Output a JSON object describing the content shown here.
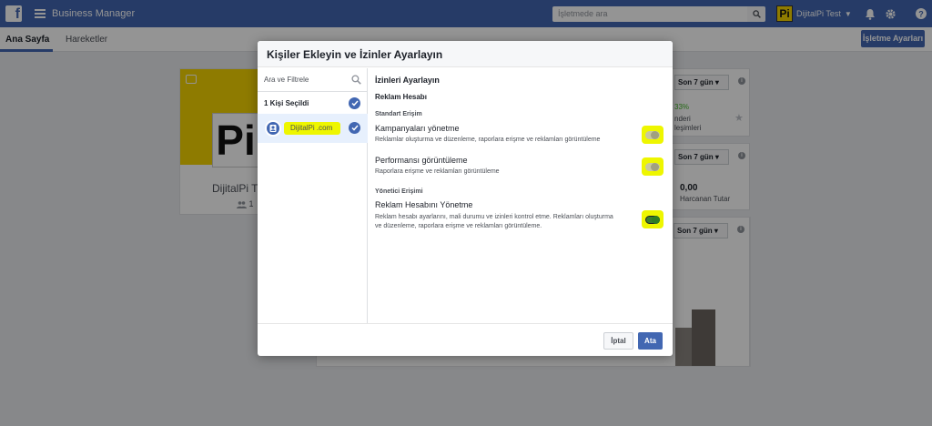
{
  "topbar": {
    "logo_letter": "f",
    "app_title": "Business Manager",
    "search_placeholder": "İşletmede ara",
    "account_logo": "Pi",
    "account_name": "DijitalPi Test",
    "icons": [
      "bell-icon",
      "gear-icon",
      "help-icon"
    ]
  },
  "subnav": {
    "tabs": [
      {
        "label": "Ana Sayfa",
        "active": true
      },
      {
        "label": "Hareketler",
        "active": false
      }
    ],
    "settings_button": "İşletme Ayarları"
  },
  "background": {
    "profile": {
      "logo_text": "Pi",
      "name": "DijitalPi T",
      "count": "1"
    },
    "cards": [
      {
        "select": "Son 7 gün",
        "line1": "33%",
        "line2": "nderi",
        "line3": "leşimleri"
      },
      {
        "select": "Son 7 gün",
        "value": "0,00",
        "label": "Harcanan Tutar"
      },
      {
        "select": "Son 7 gün"
      }
    ]
  },
  "modal": {
    "title": "Kişiler Ekleyin ve İzinler Ayarlayın",
    "left": {
      "search_placeholder": "Ara ve Filtrele",
      "selected_label": "1 Kişi Seçildi",
      "person_name": "DijitalPi .com"
    },
    "right": {
      "title": "İzinleri Ayarlayın",
      "section": "Reklam Hesabı",
      "groups": [
        {
          "label": "Standart Erişim",
          "permissions": [
            {
              "title": "Kampanyaları yönetme",
              "desc": "Reklamlar oluşturma ve düzenleme, raporlara erişme ve reklamları görüntüleme",
              "enabled": false
            },
            {
              "title": "Performansı görüntüleme",
              "desc": "Raporlara erişme ve reklamları görüntüleme",
              "enabled": false
            }
          ]
        },
        {
          "label": "Yönetici Erişimi",
          "permissions": [
            {
              "title": "Reklam Hesabını Yönetme",
              "desc": "Reklam hesabı ayarlarını, mali durumu ve izinleri kontrol etme. Reklamları oluşturma ve düzenleme, raporlara erişme ve reklamları görüntüleme.",
              "enabled": true
            }
          ]
        }
      ]
    },
    "footer": {
      "cancel": "İptal",
      "assign": "Ata"
    }
  },
  "colors": {
    "brand": "#4267b2",
    "highlight": "#eef600",
    "page_bg": "#e9ebee"
  }
}
